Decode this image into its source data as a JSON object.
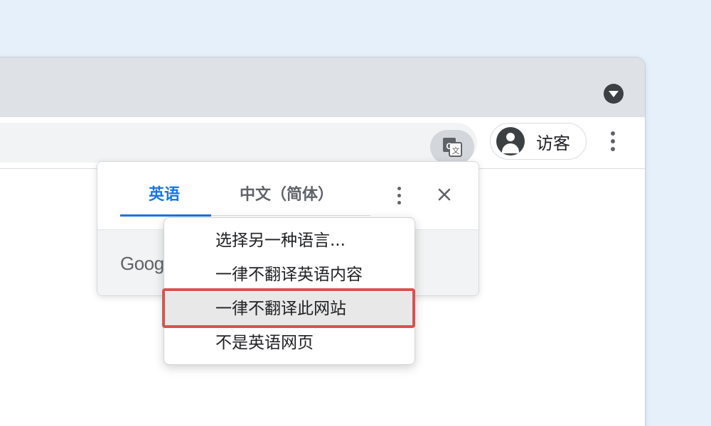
{
  "toolbar": {
    "profile_name": "访客"
  },
  "translate_bubble": {
    "source_language": "英语",
    "target_language": "中文（简体）",
    "provider_logo_text": "Google"
  },
  "options_menu": {
    "items": [
      {
        "label": "选择另一种语言..."
      },
      {
        "label": "一律不翻译英语内容"
      },
      {
        "label": "一律不翻译此网站",
        "highlighted": true
      },
      {
        "label": "不是英语网页"
      }
    ]
  },
  "colors": {
    "accent": "#1a73e8",
    "highlight_border": "#d9534f",
    "background": "#e6f0fb"
  },
  "icons": {
    "tab_search": "chevron-down-icon",
    "translate": "translate-icon",
    "avatar": "person-icon",
    "toolbar_menu": "more-vert-icon",
    "bubble_menu": "more-vert-icon",
    "close": "close-icon"
  }
}
